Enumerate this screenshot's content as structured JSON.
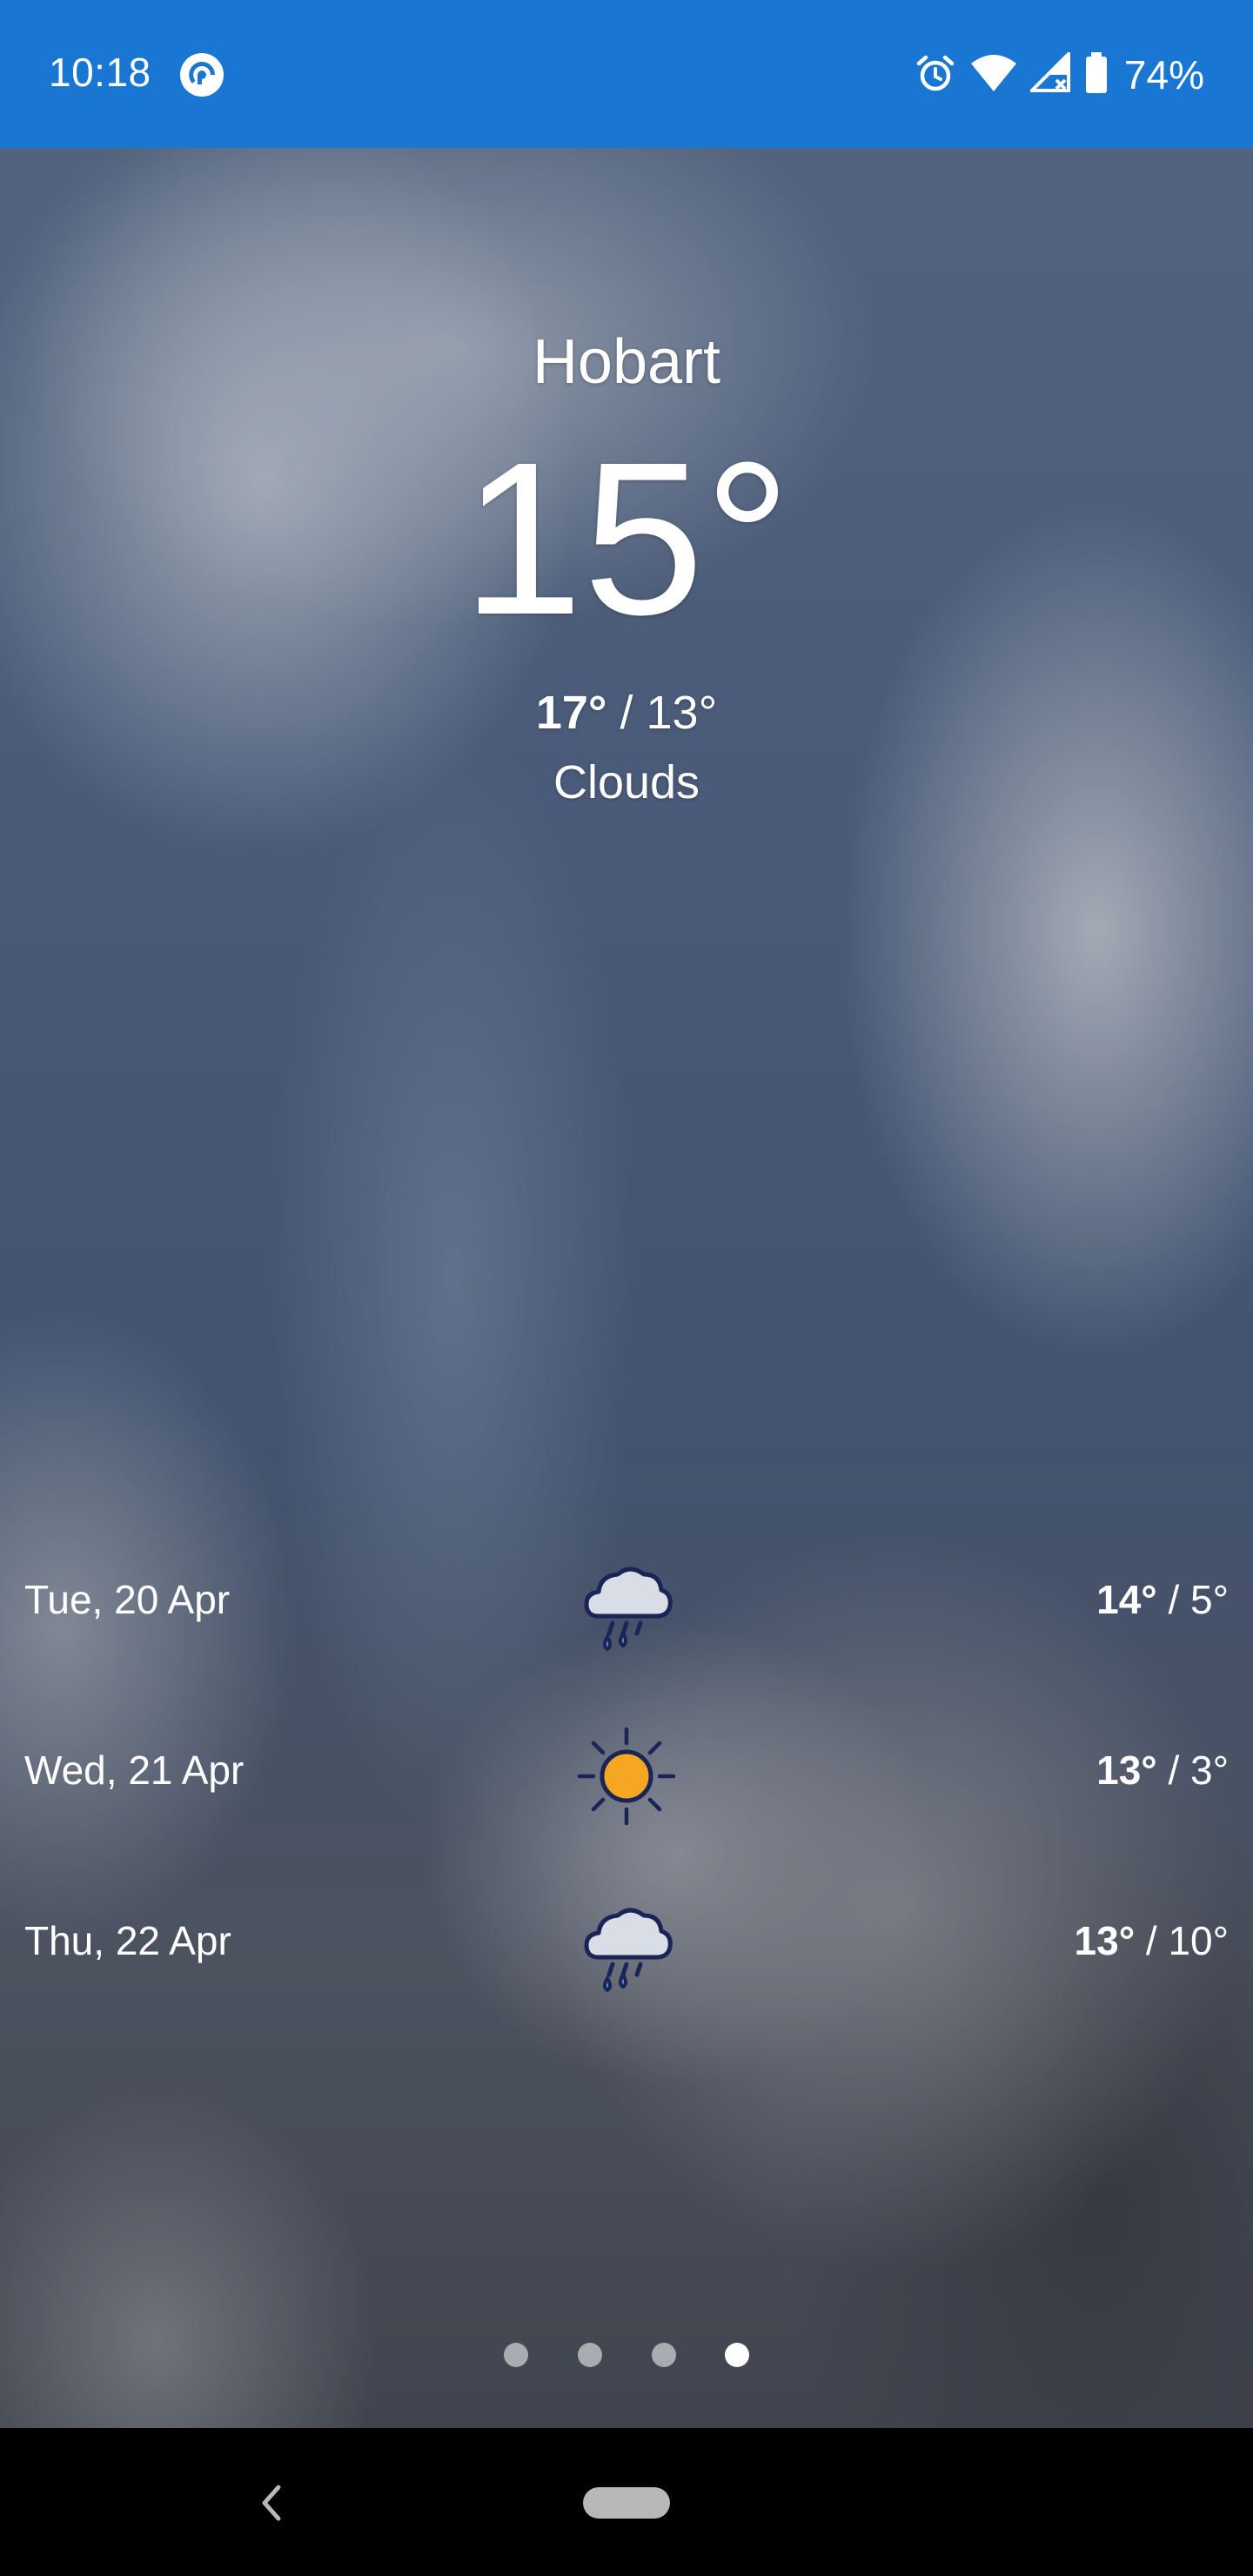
{
  "status_bar": {
    "time": "10:18",
    "battery": "74%",
    "app_icon": "pocketcasts-icon",
    "icons": [
      "alarm-icon",
      "wifi-icon",
      "cell-signal-icon",
      "battery-icon"
    ],
    "background_color": "#1976d2"
  },
  "current": {
    "city": "Hobart",
    "temperature": "15°",
    "high": "17°",
    "separator": " / ",
    "low": "13°",
    "condition": "Clouds"
  },
  "forecast": [
    {
      "date": "Tue, 20 Apr",
      "icon": "rain-cloud-icon",
      "high": "14°",
      "separator": " / ",
      "low": "5°"
    },
    {
      "date": "Wed, 21 Apr",
      "icon": "sun-icon",
      "high": "13°",
      "separator": " / ",
      "low": "3°"
    },
    {
      "date": "Thu, 22 Apr",
      "icon": "rain-cloud-icon",
      "high": "13°",
      "separator": " / ",
      "low": "10°"
    }
  ],
  "pager": {
    "page_count": 4,
    "active_page": 4
  },
  "nav_bar": {
    "icons": [
      "back-icon",
      "home-pill"
    ]
  }
}
